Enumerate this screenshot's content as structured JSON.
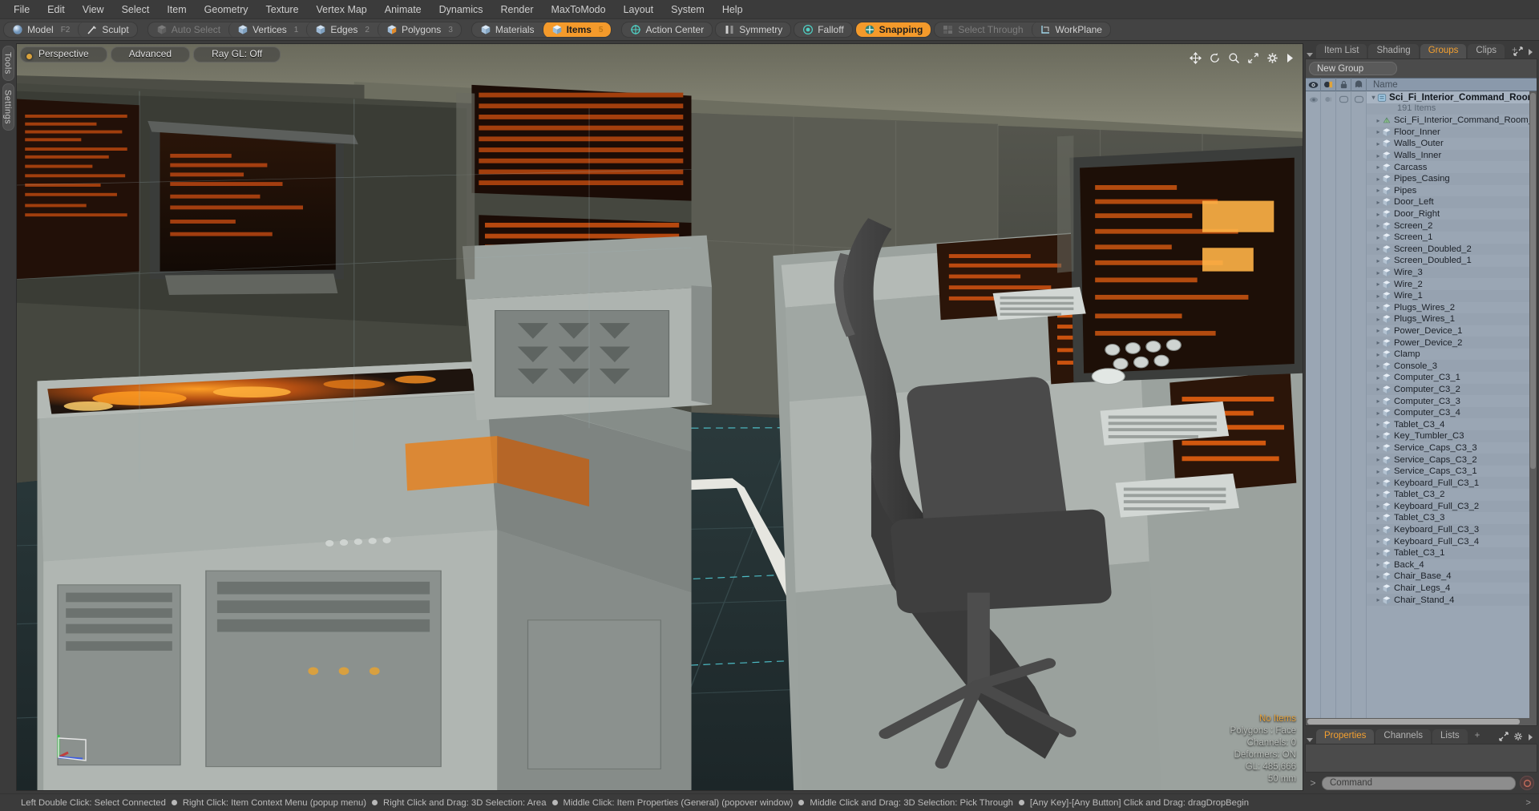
{
  "menu": {
    "items": [
      "File",
      "Edit",
      "View",
      "Select",
      "Item",
      "Geometry",
      "Texture",
      "Vertex Map",
      "Animate",
      "Dynamics",
      "Render",
      "MaxToModo",
      "Layout",
      "System",
      "Help"
    ]
  },
  "modebar": {
    "mode_group": [
      {
        "label": "Model",
        "shortcut": "F2",
        "icon": "sphere-icon",
        "active": false
      },
      {
        "label": "Sculpt",
        "shortcut": "",
        "icon": "brush-icon",
        "active": false
      }
    ],
    "select_group": [
      {
        "label": "Auto Select",
        "num": "",
        "icon": "cube-grey-icon",
        "active": false,
        "dim": true
      },
      {
        "label": "Vertices",
        "num": "1",
        "icon": "cube-vertices-icon",
        "active": false,
        "dim": false
      },
      {
        "label": "Edges",
        "num": "2",
        "icon": "cube-edges-icon",
        "active": false,
        "dim": false
      },
      {
        "label": "Polygons",
        "num": "3",
        "icon": "cube-polygons-icon",
        "active": false,
        "dim": false
      }
    ],
    "item_group": [
      {
        "label": "Materials",
        "num": "",
        "icon": "cube-blue-icon",
        "active": false,
        "dim": false
      },
      {
        "label": "Items",
        "num": "5",
        "icon": "cube-orange-icon",
        "active": true,
        "dim": false
      }
    ],
    "tool_group": [
      {
        "label": "Action Center",
        "icon": "crosshair-icon",
        "active": false,
        "dim": false
      },
      {
        "label": "Symmetry",
        "icon": "symmetry-icon",
        "active": false,
        "dim": false
      },
      {
        "label": "Falloff",
        "icon": "falloff-icon",
        "active": false,
        "dim": false
      },
      {
        "label": "Snapping",
        "icon": "snap-icon",
        "active": true,
        "dim": false
      },
      {
        "label": "Select Through",
        "icon": "select-through-icon",
        "active": false,
        "dim": true
      },
      {
        "label": "WorkPlane",
        "icon": "workplane-icon",
        "active": false,
        "dim": false
      }
    ]
  },
  "left_rail": {
    "tabs": [
      "Tools",
      "Settings"
    ]
  },
  "viewport": {
    "header_buttons": [
      "Perspective",
      "Advanced",
      "Ray GL: Off"
    ],
    "nav_icons": [
      "pan-icon",
      "rotate-icon",
      "zoom-icon",
      "fit-icon",
      "gear-icon",
      "chevron-right-icon"
    ],
    "info": {
      "selection": "No Items",
      "polygons": "Polygons : Face",
      "channels": "Channels: 0",
      "deformers": "Deformers: ON",
      "gl": "GL: 485,666",
      "scale": "50 mm"
    }
  },
  "right_panel": {
    "tabs": [
      {
        "label": "Item List",
        "selected": false
      },
      {
        "label": "Shading",
        "selected": false
      },
      {
        "label": "Groups",
        "selected": true
      },
      {
        "label": "Clips",
        "selected": false
      },
      {
        "label": "+",
        "selected": false
      }
    ],
    "new_group_button": "New Group",
    "columns": [
      "eye-icon",
      "render-icon",
      "lock-icon",
      "ghost-icon"
    ],
    "name_column": "Name",
    "root": {
      "name": "Sci_Fi_Interior_Command_Room_ ...",
      "count": "191 Items"
    },
    "items": [
      "Sci_Fi_Interior_Command_Room_Red",
      "Floor_Inner",
      "Walls_Outer",
      "Walls_Inner",
      "Carcass",
      "Pipes_Casing",
      "Pipes",
      "Door_Left",
      "Door_Right",
      "Screen_2",
      "Screen_1",
      "Screen_Doubled_2",
      "Screen_Doubled_1",
      "Wire_3",
      "Wire_2",
      "Wire_1",
      "Plugs_Wires_2",
      "Plugs_Wires_1",
      "Power_Device_1",
      "Power_Device_2",
      "Clamp",
      "Console_3",
      "Computer_C3_1",
      "Computer_C3_2",
      "Computer_C3_3",
      "Computer_C3_4",
      "Tablet_C3_4",
      "Key_Tumbler_C3",
      "Service_Caps_C3_3",
      "Service_Caps_C3_2",
      "Service_Caps_C3_1",
      "Keyboard_Full_C3_1",
      "Tablet_C3_2",
      "Keyboard_Full_C3_2",
      "Tablet_C3_3",
      "Keyboard_Full_C3_3",
      "Keyboard_Full_C3_4",
      "Tablet_C3_1",
      "Back_4",
      "Chair_Base_4",
      "Chair_Legs_4",
      "Chair_Stand_4"
    ]
  },
  "bottom_panel": {
    "tabs": [
      {
        "label": "Properties",
        "selected": true
      },
      {
        "label": "Channels",
        "selected": false
      },
      {
        "label": "Lists",
        "selected": false
      },
      {
        "label": "+",
        "selected": false
      }
    ]
  },
  "command": {
    "placeholder": "Command",
    "value": ""
  },
  "statusbar": {
    "segments": [
      "Left Double Click: Select Connected",
      "Right Click: Item Context Menu (popup menu)",
      "Right Click and Drag: 3D Selection: Area",
      "Middle Click: Item Properties (General) (popover window)",
      "Middle Click and Drag: 3D Selection: Pick Through",
      "[Any Key]-[Any Button] Click and Drag: dragDropBegin"
    ]
  },
  "colors": {
    "accent": "#f4a030",
    "panel_bg": "#3b3b3b",
    "list_bg": "#9aa6b4",
    "header_bg": "#8a99ab"
  }
}
